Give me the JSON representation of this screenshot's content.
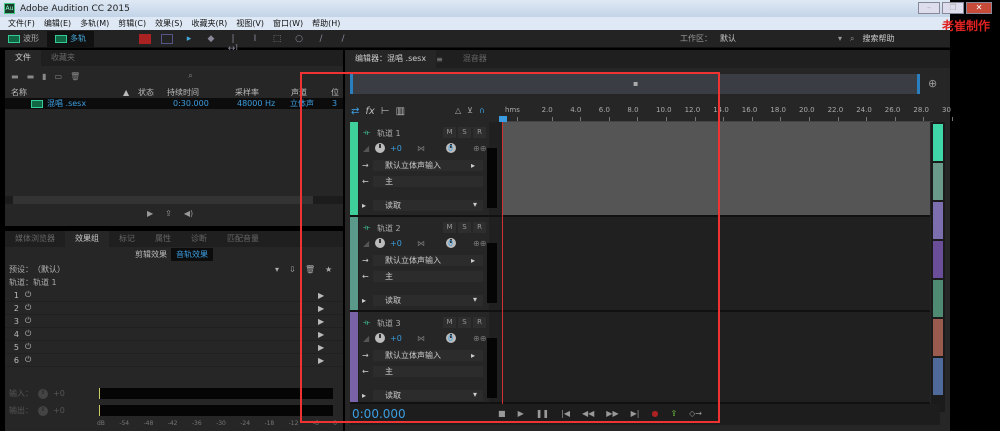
{
  "title": "Adobe Audition CC 2015",
  "app_icon": "Au",
  "watermark": "老崔制作",
  "window_buttons": [
    "–",
    "❐",
    "✕"
  ],
  "menu": [
    "文件(F)",
    "编辑(E)",
    "多轨(M)",
    "剪辑(C)",
    "效果(S)",
    "收藏夹(R)",
    "视图(V)",
    "窗口(W)",
    "帮助(H)"
  ],
  "modes": [
    "波形",
    "多轨"
  ],
  "workspace": {
    "label": "工作区：",
    "value": "默认",
    "search": "搜索帮助"
  },
  "files": {
    "tabs": [
      "文件",
      "收藏夹"
    ],
    "columns": [
      "名称",
      "状态",
      "持续时间",
      "采样率",
      "声道",
      "位"
    ],
    "rows": [
      {
        "name": "混唱 .sesx",
        "duration": "0:30.000",
        "rate": "48000 Hz",
        "channels": "立体声",
        "bits": "3"
      }
    ]
  },
  "effects": {
    "tabs": [
      "媒体浏览器",
      "效果组",
      "标记",
      "属性",
      "诊断",
      "匹配音量"
    ],
    "subtabs": [
      "剪辑效果",
      "音轨效果"
    ],
    "preset_label": "预设：",
    "preset": "（默认）",
    "track_label": "轨道：轨道 1",
    "slots": [
      "1",
      "2",
      "3",
      "4",
      "5",
      "6"
    ],
    "input": "输入：",
    "output": "输出：",
    "gain": "+0",
    "scale": [
      "dB",
      "-54",
      "-48",
      "-42",
      "-36",
      "-30",
      "-24",
      "-18",
      "-12",
      "-6",
      "0"
    ]
  },
  "editor": {
    "tab": "编辑器：混唱 .sesx",
    "tab2": "混音器",
    "ruler": [
      "hms",
      "2.0",
      "4.0",
      "6.0",
      "8.0",
      "10.0",
      "12.0",
      "14.0",
      "16.0",
      "18.0",
      "20.0",
      "22.0",
      "24.0",
      "26.0",
      "28.0",
      "30"
    ],
    "time": "0:00.000"
  },
  "tracks": [
    {
      "name": "轨道 1",
      "color": "#3fcf9a",
      "vol": "+0",
      "pan": "0",
      "input": "默认立体声输入",
      "output": "主",
      "mode": "读取"
    },
    {
      "name": "轨道 2",
      "color": "#5a9a8a",
      "vol": "+0",
      "pan": "0",
      "input": "默认立体声输入",
      "output": "主",
      "mode": "读取"
    },
    {
      "name": "轨道 3",
      "color": "#7a62a8",
      "vol": "+0",
      "pan": "0",
      "input": "默认立体声输入",
      "output": "主",
      "mode": "读取"
    }
  ],
  "track_buttons": [
    "M",
    "S",
    "R"
  ],
  "overview_colors": [
    "#3fd6a8",
    "#6a9a8a",
    "#7d6eb0",
    "#6a4e9a",
    "#4f8a72",
    "#9a5a4e",
    "#4f6a9a"
  ]
}
